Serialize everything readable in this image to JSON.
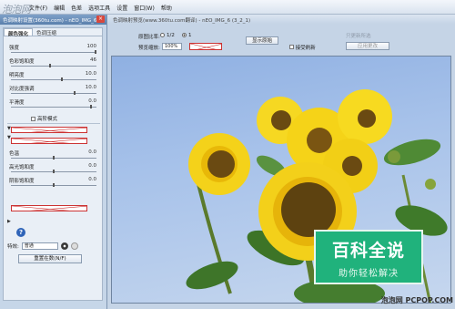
{
  "menubar": {
    "watermark": "泡泡网",
    "items": [
      "文件(F)",
      "编辑",
      "色差",
      "选项工具",
      "设置",
      "窗口(W)",
      "帮助"
    ]
  },
  "left_panel": {
    "title": "色调映射设置(360tu.com) - nEO_IMG_6",
    "tabs": [
      "颜色强化",
      "色调压缩"
    ],
    "sliders": [
      {
        "label": "强度",
        "value": "100",
        "level": 1.0
      },
      {
        "label": "色彩饱和度",
        "value": "46",
        "level": 0.46
      },
      {
        "label": "明亮度",
        "value": "10.0",
        "level": 0.6
      },
      {
        "label": "对比度强调",
        "value": "10.0",
        "level": 0.75
      },
      {
        "label": "平滑度",
        "value": "0.0",
        "level": 0.95
      }
    ],
    "sliders2": [
      {
        "label": "色温",
        "value": "0.0",
        "level": 0.5
      },
      {
        "label": "高光饱和度",
        "value": "0.0",
        "level": 0.5
      },
      {
        "label": "阴影饱和度",
        "value": "0.0",
        "level": 0.5
      }
    ],
    "checkbox_label": "高阶模式",
    "feature_label": "特效:",
    "feature_value": "普通",
    "reset_button": "重置在数(N/F)"
  },
  "main": {
    "title": "色调映射预览(www.360tu.com翻译) - nEO_IMG_6 (3_2_1)",
    "original_ratio_label": "原图比率:",
    "ratio_options": [
      "1/2",
      "1"
    ],
    "preview_zoom_label": "预览缩放:",
    "preview_zoom_value": "100%",
    "show_original_button": "显示原始",
    "auto_refresh_label": "接受刷新",
    "apply_button": "应用更改",
    "disabled_hint": "只更新所选"
  },
  "badge": {
    "title": "百科全说",
    "subtitle": "助你轻松解决"
  },
  "footer_watermark": "泡泡网 PCPOP.COM",
  "colors": {
    "accent": "#20b27c",
    "title_blue": "#5a7fac"
  }
}
